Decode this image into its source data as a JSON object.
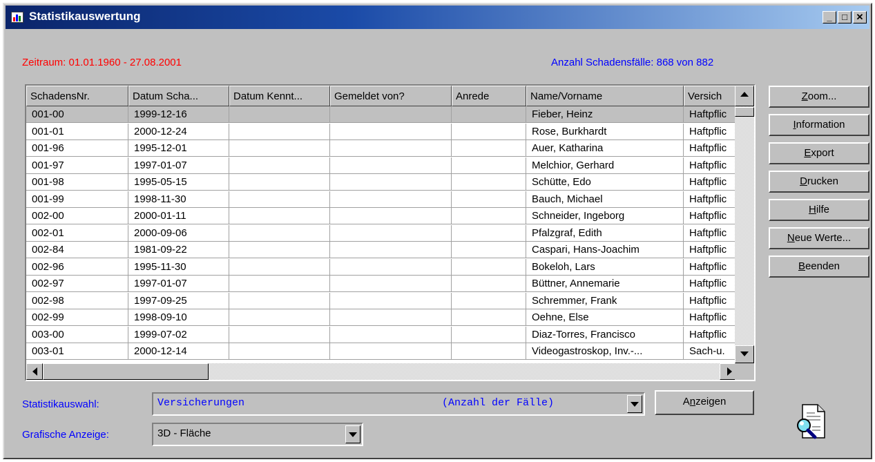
{
  "window": {
    "title": "Statistikauswertung",
    "minimize_glyph": "_",
    "maximize_glyph": "□",
    "close_glyph": "✕"
  },
  "zeitraum": "Zeitraum: 01.01.1960 - 27.08.2001",
  "anzahl": "Anzahl Schadensfälle: 868 von 882",
  "table": {
    "columns": [
      "SchadensNr.",
      "Datum Scha...",
      "Datum Kennt...",
      "Gemeldet von?",
      "Anrede",
      "Name/Vorname",
      "Versich"
    ],
    "rows": [
      [
        "001-00",
        "1999-12-16",
        "",
        "",
        "",
        "Fieber, Heinz",
        "Haftpflic"
      ],
      [
        "001-01",
        "2000-12-24",
        "",
        "",
        "",
        "Rose, Burkhardt",
        "Haftpflic"
      ],
      [
        "001-96",
        "1995-12-01",
        "",
        "",
        "",
        "Auer, Katharina",
        "Haftpflic"
      ],
      [
        "001-97",
        "1997-01-07",
        "",
        "",
        "",
        "Melchior, Gerhard",
        "Haftpflic"
      ],
      [
        "001-98",
        "1995-05-15",
        "",
        "",
        "",
        "Schütte, Edo",
        "Haftpflic"
      ],
      [
        "001-99",
        "1998-11-30",
        "",
        "",
        "",
        "Bauch, Michael",
        "Haftpflic"
      ],
      [
        "002-00",
        "2000-01-11",
        "",
        "",
        "",
        "Schneider, Ingeborg",
        "Haftpflic"
      ],
      [
        "002-01",
        "2000-09-06",
        "",
        "",
        "",
        "Pfalzgraf, Edith",
        "Haftpflic"
      ],
      [
        "002-84",
        "1981-09-22",
        "",
        "",
        "",
        "Caspari, Hans-Joachim",
        "Haftpflic"
      ],
      [
        "002-96",
        "1995-11-30",
        "",
        "",
        "",
        "Bokeloh, Lars",
        "Haftpflic"
      ],
      [
        "002-97",
        "1997-01-07",
        "",
        "",
        "",
        "Büttner, Annemarie",
        "Haftpflic"
      ],
      [
        "002-98",
        "1997-09-25",
        "",
        "",
        "",
        "Schremmer, Frank",
        "Haftpflic"
      ],
      [
        "002-99",
        "1998-09-10",
        "",
        "",
        "",
        "Oehne, Else",
        "Haftpflic"
      ],
      [
        "003-00",
        "1999-07-02",
        "",
        "",
        "",
        "Diaz-Torres, Francisco",
        "Haftpflic"
      ],
      [
        "003-01",
        "2000-12-14",
        "",
        "",
        "",
        "Videogastroskop, Inv.-...",
        "Sach-u."
      ]
    ],
    "selected_row": 0
  },
  "buttons": {
    "zoom": {
      "key": "Z",
      "rest": "oom..."
    },
    "information": {
      "key": "I",
      "rest": "nformation"
    },
    "export": {
      "key": "E",
      "rest": "xport"
    },
    "drucken": {
      "key": "D",
      "rest": "rucken"
    },
    "hilfe": {
      "key": "H",
      "rest": "ilfe"
    },
    "neue_werte": {
      "key": "N",
      "rest": "eue Werte..."
    },
    "beenden": {
      "key": "B",
      "rest": "eenden"
    },
    "anzeigen": {
      "pre": "A",
      "key": "n",
      "rest": "zeigen"
    }
  },
  "statistik": {
    "label": "Statistikauswahl:",
    "value": "Versicherungen",
    "suffix": "(Anzahl der Fälle)"
  },
  "grafik": {
    "label": "Grafische Anzeige:",
    "value": "3D - Fläche"
  },
  "colors": {
    "red_label": "#ff0000",
    "blue_label": "#0000ff",
    "titlebar_start": "#0a246a",
    "face": "#c0c0c0"
  }
}
